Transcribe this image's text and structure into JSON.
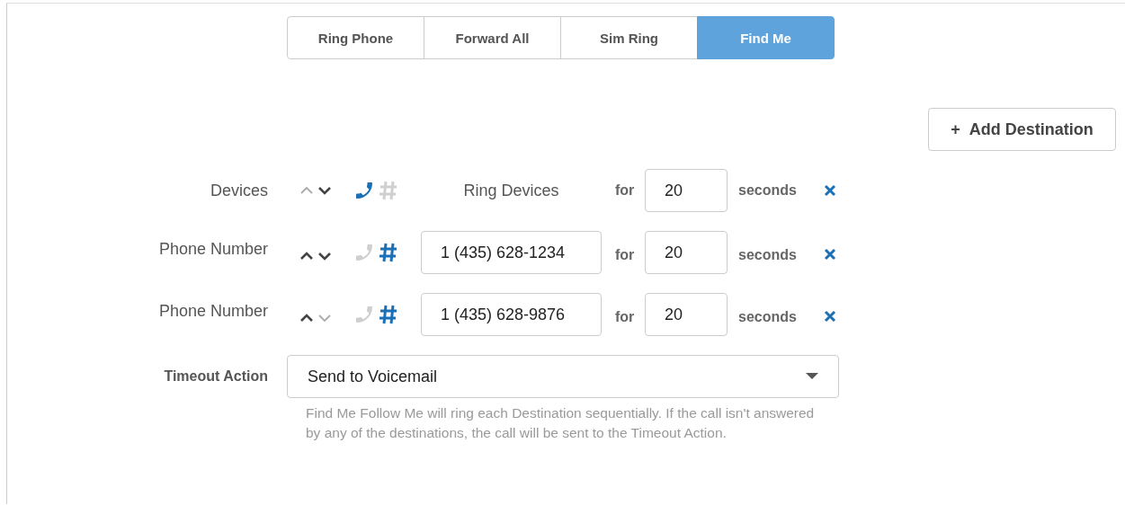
{
  "tabs": [
    {
      "label": "Ring Phone",
      "selected": false
    },
    {
      "label": "Forward All",
      "selected": false
    },
    {
      "label": "Sim Ring",
      "selected": false
    },
    {
      "label": "Find Me",
      "selected": true
    }
  ],
  "add_button": {
    "icon": "+",
    "label": "Add Destination"
  },
  "destinations": [
    {
      "kind": "devices",
      "label": "Devices",
      "up_enabled": false,
      "down_enabled": true,
      "phone_selected": true,
      "hash_selected": false,
      "target": "Ring Devices",
      "for": "for",
      "seconds": "20",
      "unit": "seconds"
    },
    {
      "kind": "number",
      "label": "Phone Number",
      "up_enabled": true,
      "down_enabled": true,
      "phone_selected": false,
      "hash_selected": true,
      "target": "1 (435) 628-1234",
      "for": "for",
      "seconds": "20",
      "unit": "seconds"
    },
    {
      "kind": "number",
      "label": "Phone Number",
      "up_enabled": true,
      "down_enabled": false,
      "phone_selected": false,
      "hash_selected": true,
      "target": "1 (435) 628-9876",
      "for": "for",
      "seconds": "20",
      "unit": "seconds"
    }
  ],
  "timeout": {
    "label": "Timeout Action",
    "value": "Send to Voicemail",
    "help": "Find Me Follow Me will ring each Destination sequentially. If the call isn't answered by any of the destinations, the call will be sent to the Timeout Action."
  }
}
